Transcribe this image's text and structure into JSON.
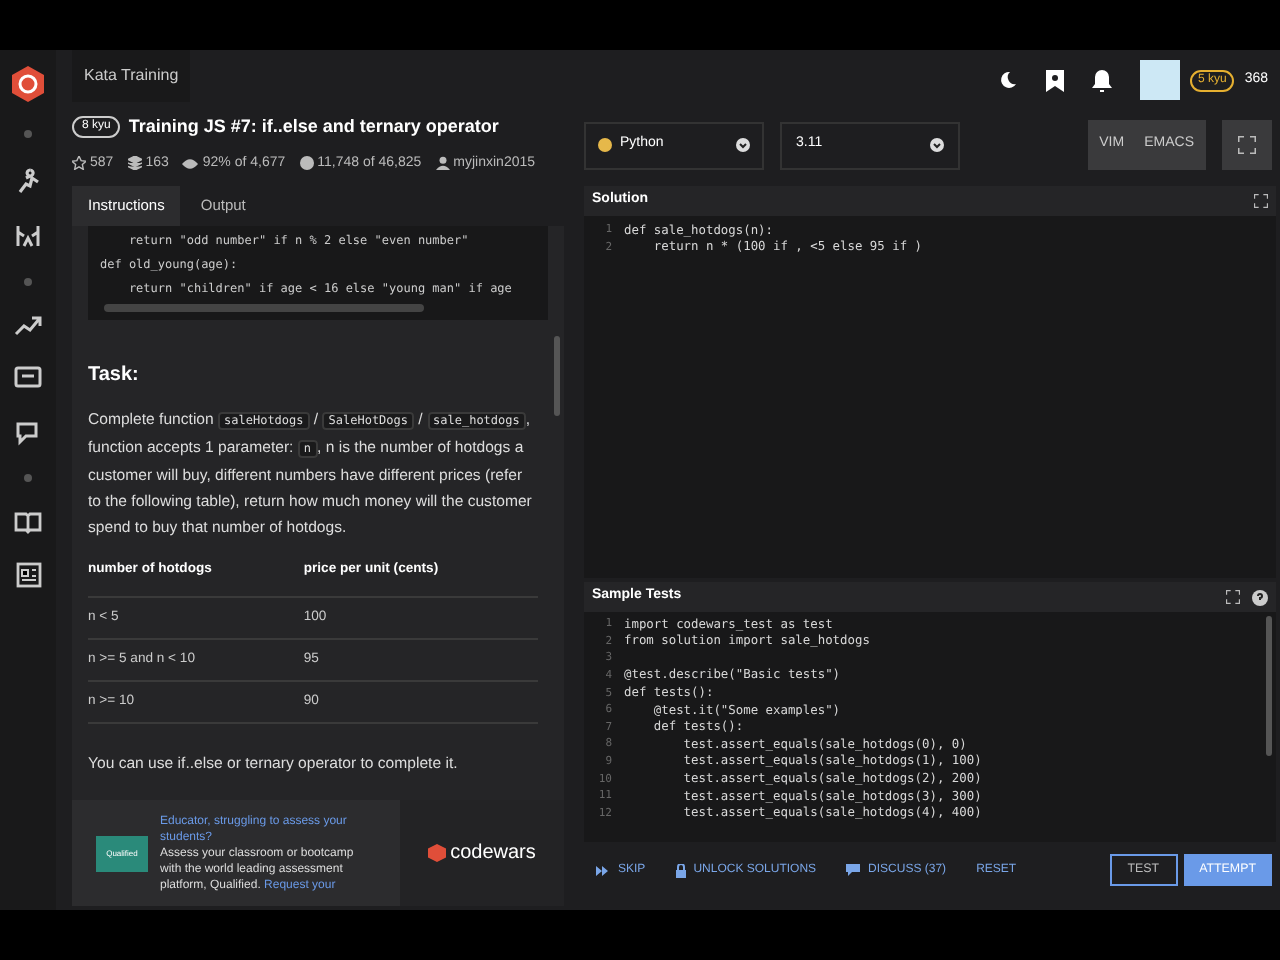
{
  "breadcrumb": "Kata Training",
  "kata": {
    "rank": "8 kyu",
    "title": "Training JS #7: if..else and ternary operator"
  },
  "stats": [
    {
      "kind": "star",
      "text": "587"
    },
    {
      "kind": "collection",
      "text": "163"
    },
    {
      "kind": "satisfaction",
      "text": "92% of 4,677"
    },
    {
      "kind": "completed",
      "text": "11,748 of 46,825"
    },
    {
      "kind": "author",
      "text": "myjinxin2015"
    }
  ],
  "tabs": [
    {
      "label": "Instructions",
      "selected": true
    },
    {
      "label": "Output",
      "selected": false
    }
  ],
  "example_code": [
    "    return \"odd number\" if n % 2 else \"even number\"",
    "def old_young(age):",
    "    return \"children\" if age < 16 else \"young man\" if age"
  ],
  "task_heading": "Task:",
  "task_text": [
    {
      "kind": "text",
      "text": "Complete function "
    },
    {
      "kind": "code",
      "text": "saleHotdogs"
    },
    {
      "kind": "text",
      "text": " / "
    },
    {
      "kind": "code",
      "text": "SaleHotDogs"
    },
    {
      "kind": "text",
      "text": " / "
    },
    {
      "kind": "code",
      "text": "sale_hotdogs"
    },
    {
      "kind": "text",
      "text": ", function accepts 1 parameter: "
    },
    {
      "kind": "code",
      "text": "n"
    },
    {
      "kind": "text",
      "text": ", n is the number of hotdogs a customer will buy, different numbers have different prices (refer to the following table), return how much money will the customer spend to buy that number of hotdogs."
    }
  ],
  "table": {
    "columns": [
      "number of hotdogs",
      "price per unit (cents)"
    ],
    "rows": [
      [
        "n < 5",
        "100"
      ],
      [
        "n >= 5 and n < 10",
        "95"
      ],
      [
        "n >= 10",
        "90"
      ]
    ]
  },
  "hint": "You can use if..else or ternary operator to complete it.",
  "ad": {
    "logo": "Qualified",
    "headline": "Educator, struggling to assess your students?",
    "text": "Assess your classroom or bootcamp with the world leading assessment platform, Qualified.",
    "link": "Request your",
    "brand": "codewars"
  },
  "user": {
    "rank": "5 kyu",
    "honor": "368"
  },
  "language": "Python",
  "version": "3.11",
  "modes": [
    "VIM",
    "EMACS"
  ],
  "solution": {
    "title": "Solution",
    "lines": [
      {
        "number": "1",
        "code": "def sale_hotdogs(n):"
      },
      {
        "number": "2",
        "code": "    return n * (100 if , <5 else 95 if )"
      }
    ]
  },
  "tests": {
    "title": "Sample Tests",
    "lines": [
      {
        "number": "1",
        "code": "import codewars_test as test"
      },
      {
        "number": "2",
        "code": "from solution import sale_hotdogs"
      },
      {
        "number": "3"
      },
      {
        "number": "4",
        "code": "@test.describe(\"Basic tests\")"
      },
      {
        "number": "5",
        "code": "def tests():"
      },
      {
        "number": "6",
        "code": "    @test.it(\"Some examples\")"
      },
      {
        "number": "7",
        "code": "    def tests():"
      },
      {
        "number": "8",
        "code": "        test.assert_equals(sale_hotdogs(0), 0)"
      },
      {
        "number": "9",
        "code": "        test.assert_equals(sale_hotdogs(1), 100)"
      },
      {
        "number": "10",
        "code": "        test.assert_equals(sale_hotdogs(2), 200)"
      },
      {
        "number": "11",
        "code": "        test.assert_equals(sale_hotdogs(3), 300)"
      },
      {
        "number": "12",
        "code": "        test.assert_equals(sale_hotdogs(4), 400)"
      }
    ]
  },
  "actions": [
    {
      "kind": "skip",
      "label": "SKIP"
    },
    {
      "kind": "unlock",
      "label": "UNLOCK SOLUTIONS"
    },
    {
      "kind": "discuss",
      "label": "DISCUSS (37)"
    },
    {
      "kind": "reset",
      "label": "RESET"
    }
  ],
  "buttons": [
    {
      "kind": "outline",
      "label": "TEST"
    },
    {
      "kind": "primary",
      "label": "ATTEMPT"
    }
  ]
}
